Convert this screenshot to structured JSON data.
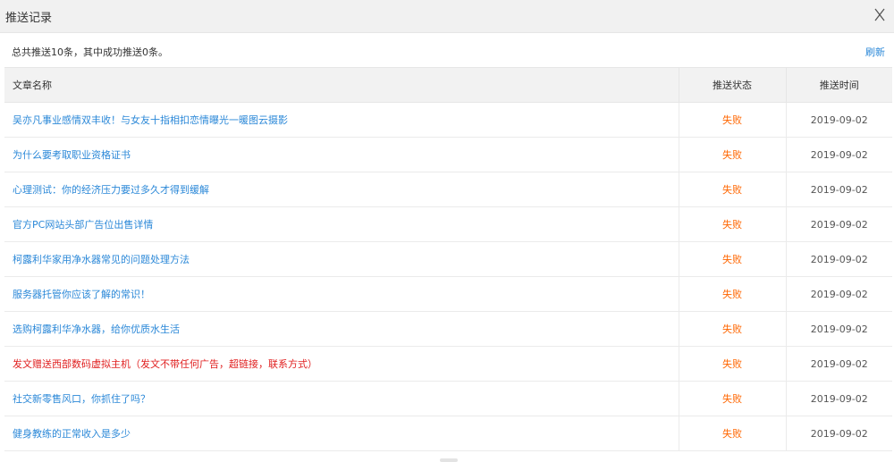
{
  "dialog": {
    "title": "推送记录",
    "close_glyph": "X"
  },
  "summary": {
    "text": "总共推送10条，其中成功推送0条。",
    "refresh_label": "刷新"
  },
  "table": {
    "headers": {
      "title": "文章名称",
      "status": "推送状态",
      "time": "推送时间"
    },
    "rows": [
      {
        "title": "吴亦凡事业感情双丰收！与女友十指相扣恋情曝光一暖图云摄影",
        "status": "失败",
        "time": "2019-09-02"
      },
      {
        "title": "为什么要考取职业资格证书",
        "status": "失败",
        "time": "2019-09-02"
      },
      {
        "title": "心理测试：你的经济压力要过多久才得到缓解",
        "status": "失败",
        "time": "2019-09-02"
      },
      {
        "title": "官方PC网站头部广告位出售详情",
        "status": "失败",
        "time": "2019-09-02"
      },
      {
        "title": "柯露利华家用净水器常见的问题处理方法",
        "status": "失败",
        "time": "2019-09-02"
      },
      {
        "title": "服务器托管你应该了解的常识！",
        "status": "失败",
        "time": "2019-09-02"
      },
      {
        "title": "选购柯露利华净水器，给你优质水生活",
        "status": "失败",
        "time": "2019-09-02"
      },
      {
        "title": "发文赠送西部数码虚拟主机（发文不带任何广告，超链接，联系方式）",
        "status": "失败",
        "time": "2019-09-02",
        "highlight": true
      },
      {
        "title": "社交新零售风口，你抓住了吗？",
        "status": "失败",
        "time": "2019-09-02"
      },
      {
        "title": "健身教练的正常收入是多少",
        "status": "失败",
        "time": "2019-09-02"
      }
    ]
  },
  "colors": {
    "link": "#2b88d8",
    "highlight_link": "#e02020",
    "status_failed": "#ff6600",
    "header_bg": "#f2f2f2",
    "titlebar_bg": "#f1f1f1"
  }
}
